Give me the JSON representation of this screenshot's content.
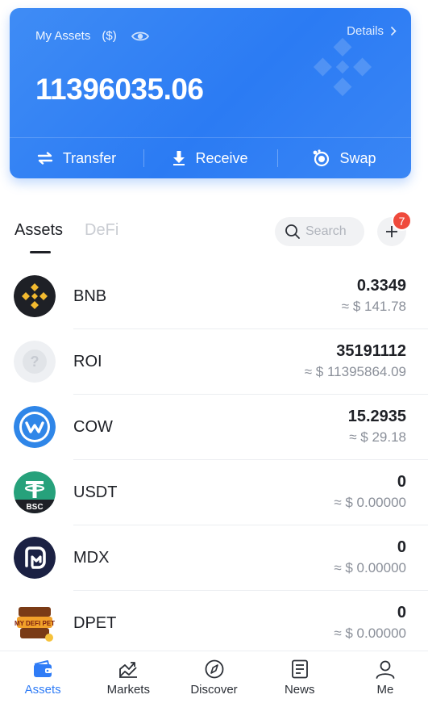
{
  "card": {
    "title": "My Assets",
    "unit": "($)",
    "details_label": "Details",
    "balance": "11396035.06",
    "actions": {
      "transfer": "Transfer",
      "receive": "Receive",
      "swap": "Swap"
    }
  },
  "tabs": {
    "assets": "Assets",
    "defi": "DeFi"
  },
  "search": {
    "placeholder": "Search"
  },
  "notification_badge": "7",
  "tokens": [
    {
      "symbol": "BNB",
      "amount": "0.3349",
      "fiat": "≈ $ 141.78",
      "icon": "bnb-logo-icon"
    },
    {
      "symbol": "ROI",
      "amount": "35191112",
      "fiat": "≈ $ 11395864.09",
      "icon": "unknown-token-icon"
    },
    {
      "symbol": "COW",
      "amount": "15.2935",
      "fiat": "≈ $ 29.18",
      "icon": "cow-logo-icon"
    },
    {
      "symbol": "USDT",
      "amount": "0",
      "fiat": "≈ $ 0.00000",
      "icon": "usdt-bsc-logo-icon",
      "icon_text": "BSC"
    },
    {
      "symbol": "MDX",
      "amount": "0",
      "fiat": "≈ $ 0.00000",
      "icon": "mdx-logo-icon"
    },
    {
      "symbol": "DPET",
      "amount": "0",
      "fiat": "≈ $ 0.00000",
      "icon": "dpet-logo-icon",
      "icon_text": "MY DEFI PET"
    }
  ],
  "bottom_nav": [
    {
      "label": "Assets",
      "icon": "wallet-icon"
    },
    {
      "label": "Markets",
      "icon": "chart-icon"
    },
    {
      "label": "Discover",
      "icon": "compass-icon"
    },
    {
      "label": "News",
      "icon": "news-icon"
    },
    {
      "label": "Me",
      "icon": "user-icon"
    }
  ],
  "colors": {
    "card_blue": "#2b7bf3",
    "accent_blue": "#2f7cf6",
    "badge_red": "#ef4a3c",
    "bnb_yellow": "#f3ba2f",
    "usdt_green": "#26a17b"
  }
}
